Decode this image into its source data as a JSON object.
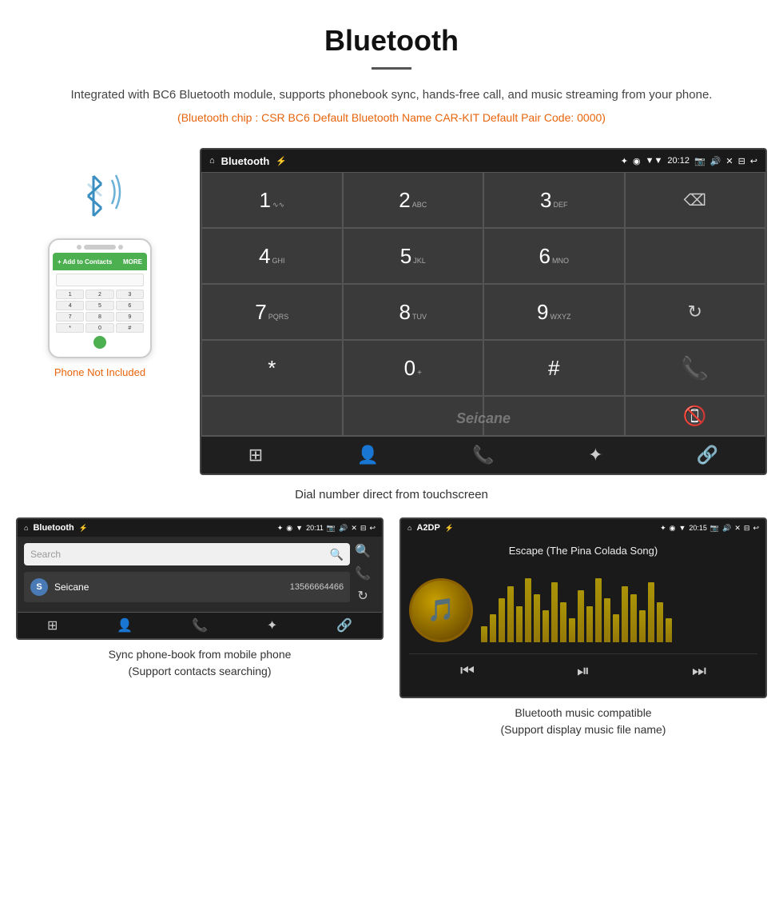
{
  "header": {
    "title": "Bluetooth",
    "description": "Integrated with BC6 Bluetooth module, supports phonebook sync, hands-free call, and music streaming from your phone.",
    "specs": "(Bluetooth chip : CSR BC6    Default Bluetooth Name CAR-KIT    Default Pair Code: 0000)"
  },
  "phone_label": "Phone Not Included",
  "main_screen": {
    "status_bar": {
      "home": "⌂",
      "title": "Bluetooth",
      "usb_icon": "⚡",
      "time": "20:12",
      "icons": "✦ ◉ ▼ ☐ 🔊 ✕ ⊟ ↩"
    },
    "dialpad": [
      {
        "num": "1",
        "sub": "∿∿"
      },
      {
        "num": "2",
        "sub": "ABC"
      },
      {
        "num": "3",
        "sub": "DEF"
      },
      {
        "special": "backspace"
      },
      {
        "num": "4",
        "sub": "GHI"
      },
      {
        "num": "5",
        "sub": "JKL"
      },
      {
        "num": "6",
        "sub": "MNO"
      },
      {
        "special": "empty"
      },
      {
        "num": "7",
        "sub": "PQRS"
      },
      {
        "num": "8",
        "sub": "TUV"
      },
      {
        "num": "9",
        "sub": "WXYZ"
      },
      {
        "special": "refresh"
      },
      {
        "num": "*",
        "sub": ""
      },
      {
        "num": "0",
        "sub": "+"
      },
      {
        "num": "#",
        "sub": ""
      },
      {
        "special": "call-green"
      },
      {
        "special": "empty2"
      },
      {
        "special": "empty3"
      },
      {
        "special": "empty4"
      },
      {
        "special": "call-red"
      }
    ],
    "bottom_nav": [
      "⊞",
      "👤",
      "📞",
      "✦",
      "🔗"
    ]
  },
  "caption_main": "Dial number direct from touchscreen",
  "contacts_screen": {
    "status_bar": {
      "home": "⌂",
      "title": "Bluetooth",
      "usb": "⚡",
      "time": "20:11",
      "icons": "✦ ◉ ▼ ☐ 🔊 ✕ ⊟ ↩"
    },
    "search_placeholder": "Search",
    "contacts": [
      {
        "initial": "S",
        "name": "Seicane",
        "number": "13566664466"
      }
    ],
    "right_icons": [
      "🔍",
      "📞",
      "↻"
    ],
    "bottom_nav": [
      "⊞",
      "👤",
      "📞",
      "✦",
      "🔗"
    ]
  },
  "music_screen": {
    "status_bar": {
      "home": "⌂",
      "title": "A2DP",
      "usb": "⚡",
      "time": "20:15",
      "icons": "✦ ◉ ▼ ☐ 🔊 ✕ ⊟ ↩"
    },
    "song_title": "Escape (The Pina Colada Song)",
    "eq_bars": [
      20,
      35,
      55,
      70,
      45,
      80,
      60,
      40,
      75,
      50,
      30,
      65,
      45,
      80,
      55,
      35,
      70,
      60,
      40,
      75,
      50,
      30
    ],
    "controls": [
      "⏮",
      "⏯",
      "⏭"
    ]
  },
  "caption_contacts": "Sync phone-book from mobile phone\n(Support contacts searching)",
  "caption_music": "Bluetooth music compatible\n(Support display music file name)"
}
